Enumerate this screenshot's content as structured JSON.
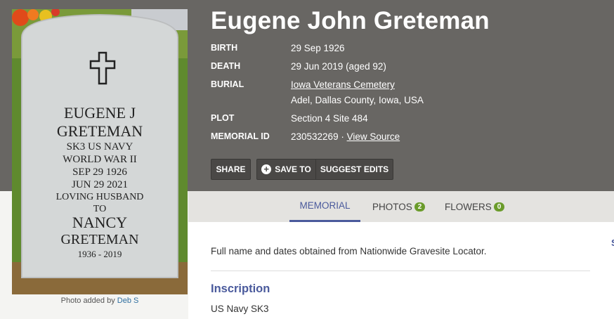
{
  "memorial": {
    "name": "Eugene John Greteman",
    "birth_label": "BIRTH",
    "birth_value": "29 Sep 1926",
    "death_label": "DEATH",
    "death_value": "29 Jun 2019 (aged 92)",
    "burial_label": "BURIAL",
    "burial_cemetery": "Iowa Veterans Cemetery",
    "burial_location": "Adel, Dallas County, Iowa, USA",
    "plot_label": "PLOT",
    "plot_value": "Section 4 Site 484",
    "memorial_id_label": "MEMORIAL ID",
    "memorial_id_value": "230532269 ·",
    "view_source": "View Source"
  },
  "actions": {
    "share": "SHARE",
    "save_to": "SAVE TO",
    "suggest_edits": "SUGGEST EDITS"
  },
  "photo": {
    "caption_prefix": "Photo added by",
    "caption_user": "Deb S",
    "headstone_lines": [
      "EUGENE J",
      "GRETEMAN",
      "SK3 US NAVY",
      "WORLD WAR II",
      "SEP 29 1926",
      "JUN 29 2021",
      "LOVING HUSBAND",
      "TO",
      "NANCY",
      "GRETEMAN",
      "1936 - 2019"
    ]
  },
  "tabs": [
    {
      "label": "MEMORIAL"
    },
    {
      "label": "PHOTOS",
      "count": "2"
    },
    {
      "label": "FLOWERS",
      "count": "0"
    }
  ],
  "content": {
    "description": "Full name and dates obtained from Nationwide Gravesite Locator.",
    "inscription_heading": "Inscription",
    "inscription_text": "US Navy SK3",
    "edge_letter": "S"
  },
  "colors": {
    "hero_bg": "#686663",
    "accent": "#4a5a9c",
    "badge": "#6a9b2a"
  }
}
